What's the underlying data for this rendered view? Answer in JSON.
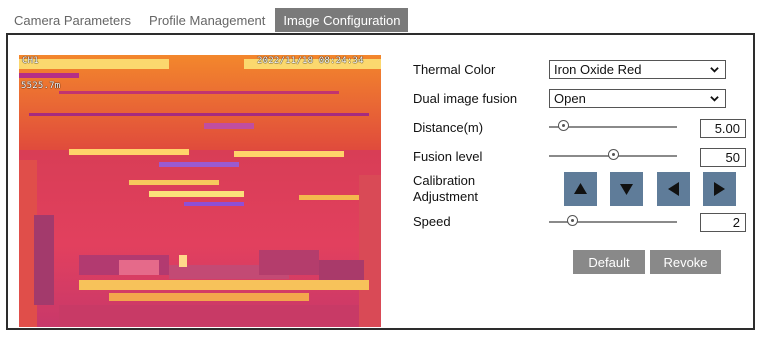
{
  "tabs": [
    "Camera Parameters",
    "Profile Management",
    "Image Configuration"
  ],
  "active_tab": "Image Configuration",
  "preview": {
    "osd_top_left": "CH1",
    "osd_distance": "5525.7m",
    "osd_datetime": "2022/11/18 08:24:34"
  },
  "settings": {
    "thermal_color": {
      "label": "Thermal Color",
      "value": "Iron Oxide Red"
    },
    "dual_image_fusion": {
      "label": "Dual image fusion",
      "value": "Open"
    },
    "distance": {
      "label": "Distance(m)",
      "value": "5.00",
      "level": 0.08
    },
    "fusion_level": {
      "label": "Fusion level",
      "value": "50",
      "level": 0.5
    },
    "calibration": {
      "label_line1": "Calibration",
      "label_line2": "Adjustment",
      "buttons": [
        "up-arrow-icon",
        "down-arrow-icon",
        "left-arrow-icon",
        "right-arrow-icon"
      ]
    },
    "speed": {
      "label": "Speed",
      "value": "2",
      "level": 0.15
    }
  },
  "actions": {
    "default_label": "Default",
    "revoke_label": "Revoke"
  },
  "colors": {
    "tab_active_bg": "#7a7a7a",
    "arrow_btn": "#5f7c99",
    "action_btn": "#898989"
  }
}
